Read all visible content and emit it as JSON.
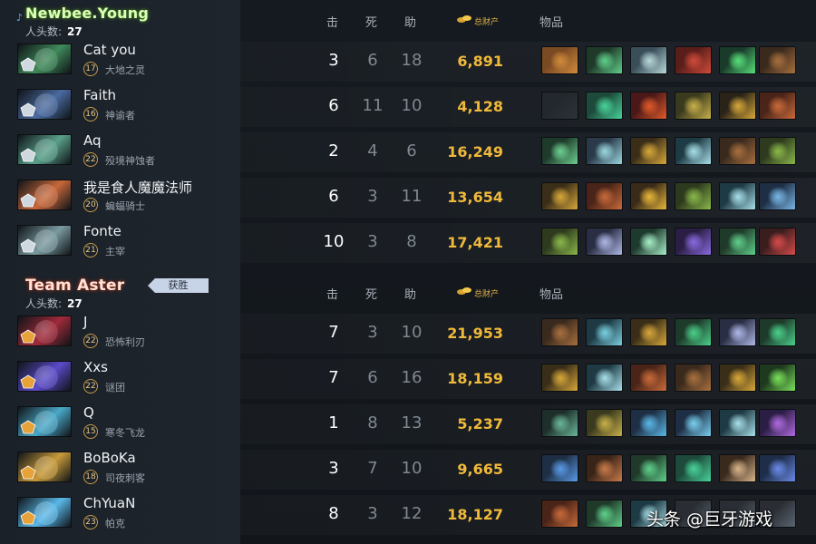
{
  "teams": [
    {
      "name": "Newbee.Young",
      "kills_label": "人头数:",
      "kills": "27",
      "header": {
        "kills": "击",
        "deaths": "死",
        "assists": "助",
        "networth": "总财产",
        "items": "物品"
      },
      "players": [
        {
          "name": "Cat you",
          "level": "17",
          "hero": "大地之灵",
          "k": "3",
          "d": "6",
          "a": "18",
          "nw": "6,891",
          "hero_icon": "earth-spirit-portrait",
          "hero_color": "#3f8a5a",
          "items": [
            {
              "icon": "ring-of-basilius-icon",
              "c1": "#7a4a22",
              "c2": "#d18b3c"
            },
            {
              "icon": "wand-icon",
              "c1": "#203a2a",
              "c2": "#5fd08a"
            },
            {
              "icon": "hammer-icon",
              "c1": "#3a4e5a",
              "c2": "#b8d9d9"
            },
            {
              "icon": "axe-icon",
              "c1": "#5a1e1a",
              "c2": "#d04a3a"
            },
            {
              "icon": "green-orb-icon",
              "c1": "#1a3a2a",
              "c2": "#57e07a"
            },
            {
              "icon": "boots-icon",
              "c1": "#3a2a1e",
              "c2": "#a8703e"
            }
          ]
        },
        {
          "name": "Faith",
          "level": "16",
          "hero": "神谕者",
          "k": "6",
          "d": "11",
          "a": "10",
          "nw": "4,128",
          "hero_icon": "oracle-portrait",
          "hero_color": "#4a6aa0",
          "items": [
            {
              "icon": "empty-slot-icon",
              "c1": "#23282e",
              "c2": "#2c3238"
            },
            {
              "icon": "arcane-boots-icon",
              "c1": "#1d4a3a",
              "c2": "#48d39a"
            },
            {
              "icon": "ring-icon",
              "c1": "#4a1818",
              "c2": "#e05a2a"
            },
            {
              "icon": "veil-icon",
              "c1": "#3a3a1e",
              "c2": "#c8b04a"
            },
            {
              "icon": "claw-icon",
              "c1": "#2a2418",
              "c2": "#d8a83a"
            },
            {
              "icon": "cloak-icon",
              "c1": "#4a2418",
              "c2": "#c86a3a"
            }
          ]
        },
        {
          "name": "Aq",
          "level": "22",
          "hero": "殁境神蚀者",
          "k": "2",
          "d": "4",
          "a": "6",
          "nw": "16,249",
          "hero_icon": "outworld-destroyer-portrait",
          "hero_color": "#5aa08a",
          "items": [
            {
              "icon": "staff-icon",
              "c1": "#1e3a2a",
              "c2": "#6ed090"
            },
            {
              "icon": "blade-icon",
              "c1": "#2a3a4a",
              "c2": "#9ad8e0"
            },
            {
              "icon": "helm-icon",
              "c1": "#3a2e18",
              "c2": "#d8a83a"
            },
            {
              "icon": "blink-dagger-icon",
              "c1": "#1e3a44",
              "c2": "#a8e0ea"
            },
            {
              "icon": "boots-icon",
              "c1": "#3a2a1e",
              "c2": "#a8703e"
            },
            {
              "icon": "drum-icon",
              "c1": "#2e3a1e",
              "c2": "#8ab84a"
            }
          ]
        },
        {
          "name": "我是食人魔魔法师",
          "level": "20",
          "hero": "蝙蝠骑士",
          "k": "6",
          "d": "3",
          "a": "11",
          "nw": "13,654",
          "hero_icon": "batrider-portrait",
          "hero_color": "#c8683a",
          "items": [
            {
              "icon": "helm-icon",
              "c1": "#3a2e18",
              "c2": "#d8a83a"
            },
            {
              "icon": "cloak-icon",
              "c1": "#4a2418",
              "c2": "#c86a3a"
            },
            {
              "icon": "gold-orb-icon",
              "c1": "#3a2a18",
              "c2": "#e8b83a"
            },
            {
              "icon": "drum-icon",
              "c1": "#2e3a1e",
              "c2": "#8ab84a"
            },
            {
              "icon": "blink-dagger-icon",
              "c1": "#1e3a44",
              "c2": "#a8e0ea"
            },
            {
              "icon": "amulet-icon",
              "c1": "#1e2e44",
              "c2": "#7ab8e8"
            }
          ]
        },
        {
          "name": "Fonte",
          "level": "21",
          "hero": "主宰",
          "k": "10",
          "d": "3",
          "a": "8",
          "nw": "17,421",
          "hero_icon": "juggernaut-portrait",
          "hero_color": "#7a9aa0",
          "items": [
            {
              "icon": "drum-icon",
              "c1": "#2e3a1e",
              "c2": "#8ab84a"
            },
            {
              "icon": "battlefury-icon",
              "c1": "#2a2e44",
              "c2": "#b0b8e8"
            },
            {
              "icon": "maelstrom-icon",
              "c1": "#1e3a2e",
              "c2": "#a8f0c8"
            },
            {
              "icon": "cape-icon",
              "c1": "#2a1e44",
              "c2": "#8a6ae0"
            },
            {
              "icon": "wand-icon",
              "c1": "#203a2a",
              "c2": "#5fd08a"
            },
            {
              "icon": "armlet-icon",
              "c1": "#3a1e1e",
              "c2": "#d84a4a"
            }
          ]
        }
      ]
    },
    {
      "name": "Team Aster",
      "victory_label": "获胜",
      "kills_label": "人头数:",
      "kills": "27",
      "header": {
        "kills": "击",
        "deaths": "死",
        "assists": "助",
        "networth": "总财产",
        "items": "物品"
      },
      "players": [
        {
          "name": "J",
          "level": "22",
          "hero": "恐怖利刃",
          "k": "7",
          "d": "3",
          "a": "10",
          "nw": "21,953",
          "hero_icon": "terrorblade-portrait",
          "hero_color": "#a02a3a",
          "items": [
            {
              "icon": "boots-icon",
              "c1": "#3a2a1e",
              "c2": "#a8703e"
            },
            {
              "icon": "manta-icon",
              "c1": "#1e3a44",
              "c2": "#7ad0e0"
            },
            {
              "icon": "helm-icon",
              "c1": "#3a2e18",
              "c2": "#d8a83a"
            },
            {
              "icon": "skadi-icon",
              "c1": "#1e3a2a",
              "c2": "#4ad08a"
            },
            {
              "icon": "battlefury-icon",
              "c1": "#2a2e44",
              "c2": "#b0b8e8"
            },
            {
              "icon": "skadi-icon",
              "c1": "#1e3a2a",
              "c2": "#4ad08a"
            }
          ]
        },
        {
          "name": "Xxs",
          "level": "22",
          "hero": "谜团",
          "k": "7",
          "d": "6",
          "a": "16",
          "nw": "18,159",
          "hero_icon": "enigma-portrait",
          "hero_color": "#5a4ac8",
          "items": [
            {
              "icon": "helm-icon",
              "c1": "#3a2e18",
              "c2": "#d8a83a"
            },
            {
              "icon": "blink-dagger-icon",
              "c1": "#1e3a44",
              "c2": "#a8e0ea"
            },
            {
              "icon": "cloak-icon",
              "c1": "#4a2418",
              "c2": "#c86a3a"
            },
            {
              "icon": "boots-icon",
              "c1": "#3a2a1e",
              "c2": "#a8703e"
            },
            {
              "icon": "helm-icon",
              "c1": "#3a2e18",
              "c2": "#d8a83a"
            },
            {
              "icon": "spiral-icon",
              "c1": "#1e3a1e",
              "c2": "#7ae05a"
            }
          ]
        },
        {
          "name": "Q",
          "level": "15",
          "hero": "寒冬飞龙",
          "k": "1",
          "d": "8",
          "a": "13",
          "nw": "5,237",
          "hero_icon": "winter-wyvern-portrait",
          "hero_color": "#4aa8c8",
          "items": [
            {
              "icon": "branch-icon",
              "c1": "#1e2e2a",
              "c2": "#6ab89a"
            },
            {
              "icon": "veil-icon",
              "c1": "#3a3a1e",
              "c2": "#c8b04a"
            },
            {
              "icon": "glimmer-icon",
              "c1": "#1e2e44",
              "c2": "#5ab8e8"
            },
            {
              "icon": "mana-potion-icon",
              "c1": "#1e2e44",
              "c2": "#7ad0f0"
            },
            {
              "icon": "blink-dagger-icon",
              "c1": "#1e3a44",
              "c2": "#a8e0ea"
            },
            {
              "icon": "purple-potion-icon",
              "c1": "#2a1e44",
              "c2": "#b06ae0"
            }
          ]
        },
        {
          "name": "BoBoKa",
          "level": "18",
          "hero": "司夜刺客",
          "k": "3",
          "d": "7",
          "a": "10",
          "nw": "9,665",
          "hero_icon": "nyx-assassin-portrait",
          "hero_color": "#c89a3a",
          "items": [
            {
              "icon": "eul-icon",
              "c1": "#1e2e44",
              "c2": "#5a9ae8"
            },
            {
              "icon": "ball-icon",
              "c1": "#3a2418",
              "c2": "#c87a4a"
            },
            {
              "icon": "wand-icon",
              "c1": "#203a2a",
              "c2": "#5fd08a"
            },
            {
              "icon": "arcane-boots-icon",
              "c1": "#1d4a3a",
              "c2": "#48d39a"
            },
            {
              "icon": "axe-icon",
              "c1": "#3a2a1e",
              "c2": "#d8b48a"
            },
            {
              "icon": "scepter-icon",
              "c1": "#1e2e4a",
              "c2": "#6a8ae8"
            }
          ]
        },
        {
          "name": "ChYuaN",
          "level": "23",
          "hero": "帕克",
          "k": "8",
          "d": "3",
          "a": "12",
          "nw": "18,127",
          "hero_icon": "puck-portrait",
          "hero_color": "#5ab8e8",
          "items": [
            {
              "icon": "cloak-icon",
              "c1": "#4a2418",
              "c2": "#c86a3a"
            },
            {
              "icon": "wand-icon",
              "c1": "#203a2a",
              "c2": "#5fd08a"
            },
            {
              "icon": "blink-dagger-icon",
              "c1": "#1e3a44",
              "c2": "#a8e0ea"
            },
            {
              "icon": "hidden-item-icon",
              "c1": "#2a2e34",
              "c2": "#5a6470"
            },
            {
              "icon": "hidden-item-icon",
              "c1": "#2a2e34",
              "c2": "#5a6470"
            },
            {
              "icon": "hidden-item-icon",
              "c1": "#2a2e34",
              "c2": "#5a6470"
            }
          ]
        }
      ]
    }
  ],
  "watermark": "头条 @巨牙游戏",
  "colors": {
    "networth": "#f0b93a",
    "radiant_name": "#dbffb5",
    "dire_name": "#ffe3d6",
    "victory_badge": "#c7d3e6"
  }
}
